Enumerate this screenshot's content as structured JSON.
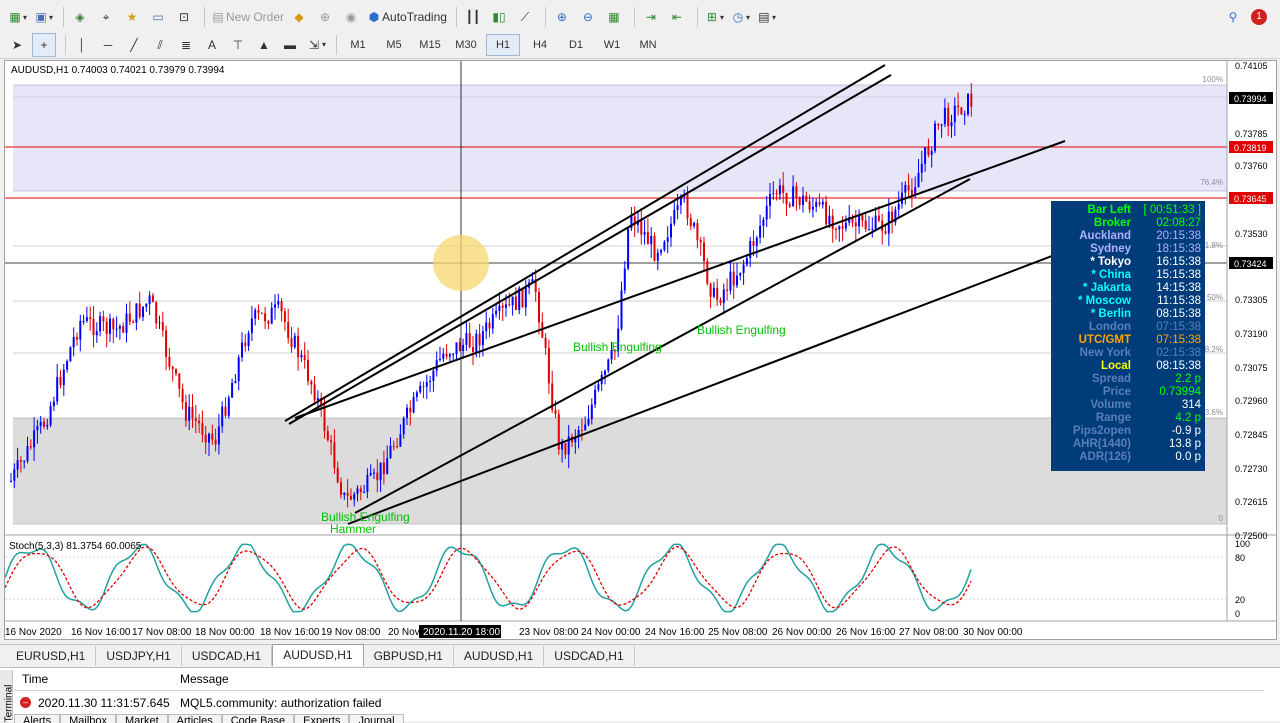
{
  "toolbar": {
    "new_order_label": "New Order",
    "autotrading_label": "AutoTrading",
    "timeframes": [
      "M1",
      "M5",
      "M15",
      "M30",
      "H1",
      "H4",
      "D1",
      "W1",
      "MN"
    ],
    "active_timeframe": "H1",
    "notification_count": "1"
  },
  "chart": {
    "symbol_line": "AUDUSD,H1  0.74003 0.74021 0.73979 0.73994",
    "stoch_line": "Stoch(5,3,3) 81.3754 60.0065",
    "price_axis": [
      "0.74105",
      "0.73994",
      "0.73785",
      "0.73819",
      "0.73760",
      "0.73645",
      "0.73530",
      "0.73424",
      "0.73305",
      "0.73190",
      "0.73075",
      "0.72960",
      "0.72845",
      "0.72730",
      "0.72615",
      "0.72500"
    ],
    "price_tags": [
      {
        "text": "0.73994",
        "color": "#000000"
      },
      {
        "text": "0.73819",
        "color": "#e00000"
      },
      {
        "text": "0.73645",
        "color": "#e00000"
      },
      {
        "text": "0.73424",
        "color": "#000000"
      }
    ],
    "fib_labels": [
      "100%",
      "76.4%",
      "61.8%",
      "50%",
      "38.2%",
      "23.6%",
      "0"
    ],
    "stoch_axis": [
      "100",
      "80",
      "20",
      "0"
    ],
    "time_axis": [
      "16 Nov 2020",
      "16 Nov 16:00",
      "17 Nov 08:00",
      "18 Nov 00:00",
      "18 Nov 16:00",
      "19 Nov 08:00",
      "20 Nov",
      "23 Nov 08:00",
      "24 Nov 00:00",
      "24 Nov 16:00",
      "25 Nov 08:00",
      "26 Nov 00:00",
      "26 Nov 16:00",
      "27 Nov 08:00",
      "30 Nov 00:00"
    ],
    "crosshair_time": "2020.11.20 18:00",
    "pattern_labels": [
      "Bullish Engulfing",
      "Bullish Engulfing",
      "Bullish Engulfing",
      "Hammer"
    ],
    "colors": {
      "bull": "#0000ff",
      "bear": "#e00000",
      "stoch_main": "#20a0a0",
      "stoch_signal": "#e00000",
      "fib_upper": "#e6e6f8",
      "fib_lower": "#dcdcdc",
      "pattern": "#00c000"
    }
  },
  "info_panel": {
    "rows": [
      {
        "label": "Bar Left",
        "value": "[ 00:51:33 ]",
        "lc": "#00ff00",
        "vc": "#00ff00"
      },
      {
        "label": "Broker",
        "value": "02:08:27",
        "lc": "#00ff00",
        "vc": "#00ff00"
      },
      {
        "label": "Auckland",
        "value": "20:15:38",
        "lc": "#b0b0ff",
        "vc": "#b0b0ff"
      },
      {
        "label": "Sydney",
        "value": "18:15:38",
        "lc": "#b0b0ff",
        "vc": "#b0b0ff"
      },
      {
        "label": "* Tokyo",
        "value": "16:15:38",
        "lc": "#ffffff",
        "vc": "#ffffff"
      },
      {
        "label": "* China",
        "value": "15:15:38",
        "lc": "#00ffff",
        "vc": "#ffffff"
      },
      {
        "label": "* Jakarta",
        "value": "14:15:38",
        "lc": "#00ffff",
        "vc": "#ffffff"
      },
      {
        "label": "* Moscow",
        "value": "11:15:38",
        "lc": "#00ffff",
        "vc": "#ffffff"
      },
      {
        "label": "* Berlin",
        "value": "08:15:38",
        "lc": "#00ffff",
        "vc": "#ffffff"
      },
      {
        "label": "London",
        "value": "07:15:38",
        "lc": "#5a7fb8",
        "vc": "#5a7fb8"
      },
      {
        "label": "UTC/GMT",
        "value": "07:15:38",
        "lc": "#ffa500",
        "vc": "#ffa500"
      },
      {
        "label": "New York",
        "value": "02:15:38",
        "lc": "#5a7fb8",
        "vc": "#5a7fb8"
      },
      {
        "label": "Local",
        "value": "08:15:38",
        "lc": "#ffff00",
        "vc": "#ffffff"
      },
      {
        "label": "Spread",
        "value": "2.2 p",
        "lc": "#5a7fb8",
        "vc": "#00ff00"
      },
      {
        "label": "Price",
        "value": "0.73994",
        "lc": "#5a7fb8",
        "vc": "#00ff00"
      },
      {
        "label": "Volume",
        "value": "314",
        "lc": "#5a7fb8",
        "vc": "#ffffff"
      },
      {
        "label": "Range",
        "value": "4.2 p",
        "lc": "#5a7fb8",
        "vc": "#00ff00"
      },
      {
        "label": "Pips2open",
        "value": "-0.9 p",
        "lc": "#5a7fb8",
        "vc": "#ffffff"
      },
      {
        "label": "AHR(1440)",
        "value": "13.8 p",
        "lc": "#5a7fb8",
        "vc": "#ffffff"
      },
      {
        "label": "ADR(126)",
        "value": "0.0 p",
        "lc": "#5a7fb8",
        "vc": "#ffffff"
      }
    ]
  },
  "symbol_tabs": [
    "EURUSD,H1",
    "USDJPY,H1",
    "USDCAD,H1",
    "AUDUSD,H1",
    "GBPUSD,H1",
    "AUDUSD,H1",
    "USDCAD,H1"
  ],
  "active_tab_index": 3,
  "terminal": {
    "col_time": "Time",
    "col_message": "Message",
    "row_time": "2020.11.30 11:31:57.645",
    "row_message": "MQL5.community: authorization failed",
    "tabs": [
      "Alerts",
      "Mailbox",
      "Market",
      "Articles",
      "Code Base",
      "Experts",
      "Journal"
    ],
    "side_label": "Terminal"
  }
}
